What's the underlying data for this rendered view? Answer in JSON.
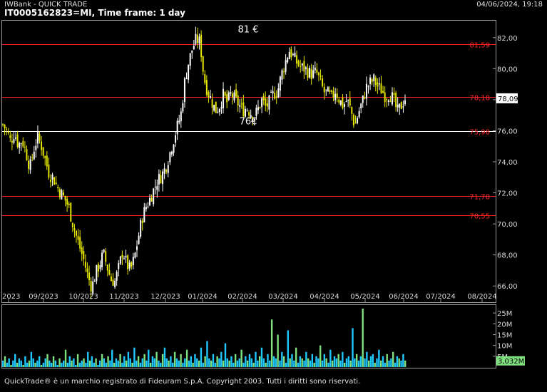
{
  "header": {
    "app_title": "IWBank - QUICK TRADE",
    "datetime": "04/06/2024, 19:18",
    "chart_title": "IT0005162823=MI, Time frame: 1 day"
  },
  "footer": {
    "copyright": "QuickTrade® è un marchio registrato di Fideuram S.p.A. Copyright 2003. Tutti i diritti sono riservati."
  },
  "colors": {
    "background": "#000000",
    "bull_candle": "#ffffff",
    "bear_candle": "#e6e600",
    "resistance_line": "#ff2020",
    "support_line": "#ffffff",
    "volume_blue": "#1ec8ff",
    "volume_green": "#7ee07e",
    "last_price_box": "#ffffff",
    "vol_value_box": "#7ee07e"
  },
  "chart_data": [
    {
      "type": "candlestick",
      "ylim": [
        65,
        83
      ],
      "yticks": [
        "66,00",
        "68,00",
        "70,00",
        "72,00",
        "74,00",
        "76,00",
        "78,00",
        "80,00",
        "82,00"
      ],
      "xticks": [
        "2023",
        "09/2023",
        "10/2023",
        "11/2023",
        "12/2023",
        "01/2024",
        "02/2024",
        "03/2024",
        "04/2024",
        "05/2024",
        "06/2024",
        "07/2024",
        "08/2024"
      ],
      "last_price": {
        "value": 78.09,
        "label": "78,09"
      },
      "horizontal_levels": [
        {
          "value": 81.59,
          "label": "81,59",
          "color": "red"
        },
        {
          "value": 78.18,
          "label": "78,18",
          "color": "red"
        },
        {
          "value": 75.98,
          "label": "75,98",
          "color": "white"
        },
        {
          "value": 71.78,
          "label": "71,78",
          "color": "red"
        },
        {
          "value": 70.55,
          "label": "70,55",
          "color": "red"
        }
      ],
      "annotations": [
        {
          "text": "81 €",
          "near_value": 82.2
        },
        {
          "text": "76€",
          "near_value": 76.5
        }
      ],
      "close_path": [
        76.4,
        76.0,
        75.3,
        75.9,
        75.1,
        75.4,
        74.6,
        73.6,
        74.8,
        75.6,
        75.0,
        74.1,
        73.2,
        73.0,
        72.4,
        72.0,
        71.6,
        71.1,
        70.1,
        69.2,
        68.4,
        67.6,
        66.6,
        65.9,
        66.8,
        67.4,
        68.1,
        67.2,
        66.4,
        66.3,
        67.2,
        68.3,
        67.4,
        67.0,
        67.8,
        69.1,
        70.4,
        71.1,
        71.6,
        72.2,
        72.8,
        73.1,
        73.6,
        74.4,
        75.3,
        76.2,
        77.0,
        79.1,
        80.4,
        81.3,
        81.9,
        81.7,
        79.4,
        78.5,
        77.9,
        77.3,
        77.6,
        78.3,
        77.8,
        78.4,
        78.0,
        77.7,
        77.3,
        77.5,
        77.2,
        76.9,
        77.4,
        78.0,
        77.5,
        77.9,
        78.4,
        78.5,
        79.6,
        80.4,
        81.2,
        80.8,
        80.4,
        80.1,
        80.0,
        79.8,
        79.6,
        79.8,
        79.2,
        78.5,
        78.4,
        78.1,
        78.6,
        78.0,
        77.6,
        78.0,
        77.3,
        76.3,
        77.2,
        77.9,
        78.8,
        79.1,
        79.3,
        78.8,
        78.6,
        78.2,
        78.4,
        78.0,
        77.2,
        77.6,
        78.1
      ],
      "candles_per_month": 21
    },
    {
      "type": "bar",
      "name": "volume",
      "yticks": [
        "5M",
        "10M",
        "15M",
        "20M",
        "25M"
      ],
      "ylim": [
        0,
        28
      ],
      "last_volume_label": "3,032M",
      "values_m": [
        3,
        5,
        2,
        4,
        1,
        3,
        6,
        2,
        4,
        3,
        1,
        5,
        2,
        3,
        7,
        4,
        2,
        3,
        5,
        1,
        2,
        4,
        6,
        3,
        2,
        5,
        3,
        1,
        4,
        2,
        3,
        8,
        2,
        5,
        3,
        4,
        1,
        6,
        2,
        3,
        4,
        2,
        7,
        3,
        5,
        2,
        4,
        1,
        3,
        6,
        4,
        2,
        5,
        3,
        8,
        2,
        4,
        3,
        6,
        2,
        5,
        3,
        7,
        4,
        2,
        9,
        3,
        5,
        2,
        4,
        6,
        3,
        8,
        2,
        5,
        4,
        7,
        3,
        2,
        6,
        9,
        4,
        3,
        5,
        2,
        7,
        4,
        3,
        6,
        2,
        4,
        8,
        3,
        5,
        2,
        6,
        4,
        3,
        9,
        2,
        5,
        12,
        4,
        3,
        6,
        2,
        5,
        4,
        7,
        3,
        11,
        4,
        3,
        5,
        2,
        6,
        3,
        4,
        8,
        2,
        5,
        3,
        6,
        4,
        2,
        7,
        3,
        5,
        9,
        4,
        2,
        6,
        3,
        22,
        5,
        4,
        15,
        3,
        7,
        5,
        2,
        17,
        4,
        6,
        3,
        9,
        2,
        5,
        4,
        3,
        7,
        4,
        3,
        6,
        2,
        5,
        4,
        10,
        3,
        6,
        4,
        2,
        8,
        3,
        5,
        4,
        6,
        3,
        7,
        2,
        4,
        5,
        3,
        18,
        4,
        6,
        3,
        5,
        27,
        4,
        7,
        3,
        5,
        6,
        2,
        4,
        8,
        3,
        5,
        2,
        6,
        3,
        4,
        7,
        2,
        5,
        4,
        3,
        6,
        3
      ],
      "last_value_m": 3.032
    }
  ]
}
